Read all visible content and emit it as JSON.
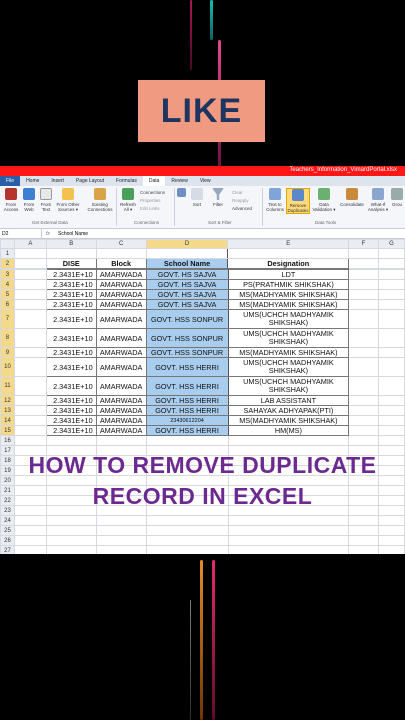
{
  "overlay": {
    "like": "LIKE",
    "line1": "HOW TO REMOVE DUPLICATE",
    "line2": "RECORD IN EXCEL"
  },
  "window": {
    "title": "Teachers_Information_VimardPortal.xlsx"
  },
  "menu": [
    "File",
    "Home",
    "Insert",
    "Page Layout",
    "Formulas",
    "Data",
    "Review",
    "View"
  ],
  "ribbon": {
    "from_access": "From\nAccess",
    "from_web": "From\nWeb",
    "from_text": "From\nText",
    "from_other": "From Other\nSources ▾",
    "existing": "Existing\nConnections",
    "refresh": "Refresh\nAll ▾",
    "connections": "Connections",
    "properties": "Properties",
    "edit_links": "Edit Links",
    "sort": "Sort",
    "filter": "Filter",
    "clear": "Clear",
    "reapply": "Reapply",
    "advanced": "Advanced",
    "text_to_columns": "Text to\nColumns",
    "remove_duplicates": "Remove\nDuplicates",
    "data_validation": "Data\nValidation ▾",
    "consolidate": "Consolidate",
    "what_if": "What-If\nAnalysis ▾",
    "group": "Grou",
    "group_external": "Get External Data",
    "group_connections": "Connections",
    "group_sort": "Sort & Filter",
    "group_tools": "Data Tools"
  },
  "formula_bar": {
    "name_box": "D2",
    "fx": "fx",
    "value": "School Name"
  },
  "columns": [
    "A",
    "B",
    "C",
    "D",
    "E",
    "F",
    "G"
  ],
  "header_row": {
    "dise": "DISE",
    "block": "Block",
    "school": "School Name",
    "designation": "Designation"
  },
  "rows": [
    {
      "n": "3",
      "dise": "2.3431E+10",
      "block": "AMARWADA",
      "school": "GOVT. HS SAJVA",
      "des": "LDT"
    },
    {
      "n": "4",
      "dise": "2.3431E+10",
      "block": "AMARWADA",
      "school": "GOVT. HS SAJVA",
      "des": "PS(PRATHMIK SHIKSHAK)"
    },
    {
      "n": "5",
      "dise": "2.3431E+10",
      "block": "AMARWADA",
      "school": "GOVT. HS SAJVA",
      "des": "MS(MADHYAMIK SHIKSHAK)"
    },
    {
      "n": "6",
      "dise": "2.3431E+10",
      "block": "AMARWADA",
      "school": "GOVT. HS SAJVA",
      "des": "MS(MADHYAMIK SHIKSHAK)"
    },
    {
      "n": "7",
      "dise": "2.3431E+10",
      "block": "AMARWADA",
      "school": "GOVT. HSS SONPUR",
      "des": "UMS(UCHCH MADHYAMIK SHIKSHAK)"
    },
    {
      "n": "8",
      "dise": "2.3431E+10",
      "block": "AMARWADA",
      "school": "GOVT. HSS SONPUR",
      "des": "UMS(UCHCH MADHYAMIK SHIKSHAK)"
    },
    {
      "n": "9",
      "dise": "2.3431E+10",
      "block": "AMARWADA",
      "school": "GOVT. HSS SONPUR",
      "des": "MS(MADHYAMIK SHIKSHAK)"
    },
    {
      "n": "10",
      "dise": "2.3431E+10",
      "block": "AMARWADA",
      "school": "GOVT. HSS HERRI",
      "des": "UMS(UCHCH MADHYAMIK SHIKSHAK)"
    },
    {
      "n": "11",
      "dise": "2.3431E+10",
      "block": "AMARWADA",
      "school": "GOVT. HSS HERRI",
      "des": "UMS(UCHCH MADHYAMIK SHIKSHAK)"
    },
    {
      "n": "12",
      "dise": "2.3431E+10",
      "block": "AMARWADA",
      "school": "GOVT. HSS HERRI",
      "des": "LAB ASSISTANT"
    },
    {
      "n": "13",
      "dise": "2.3431E+10",
      "block": "AMARWADA",
      "school": "GOVT. HSS HERRI",
      "des": "SAHAYAK ADHYAPAK(PTI)"
    },
    {
      "n": "14",
      "dise": "2.3431E+10",
      "block": "AMARWADA",
      "school": "23430612204",
      "des": "MS(MADHYAMIK SHIKSHAK)"
    },
    {
      "n": "15",
      "dise": "2.3431E+10",
      "block": "AMARWADA",
      "school": "GOVT. HSS HERRI",
      "des": "HM(MS)"
    }
  ],
  "empty_rows": [
    "16",
    "17",
    "18",
    "19",
    "20",
    "21",
    "22",
    "23",
    "24",
    "25",
    "26",
    "27",
    "28",
    "29",
    "30",
    "31",
    "32",
    "33",
    "34"
  ],
  "colors": {
    "title_red": "#ff1616",
    "like_bg": "#f09a82",
    "like_text": "#1e3560",
    "overlay_text": "#6c2a91",
    "selection_blue": "#a9cdee"
  }
}
